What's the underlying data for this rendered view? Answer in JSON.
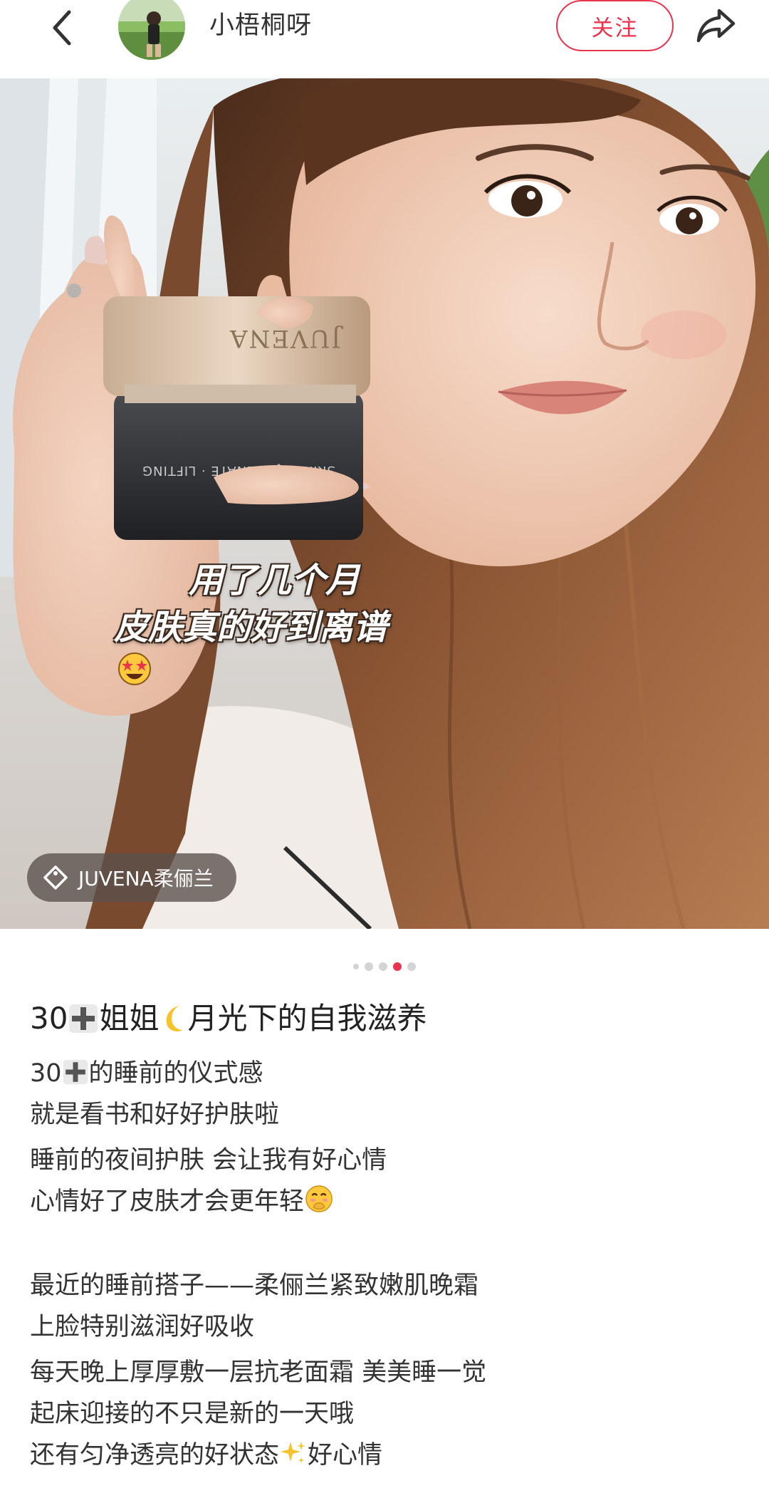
{
  "header": {
    "back_icon": "chevron-left-icon",
    "author_name": "小梧桐呀",
    "follow_label": "关注",
    "share_icon": "share-arrow-icon"
  },
  "photo": {
    "overlay_line1": "用了几个月",
    "overlay_line2": "皮肤真的好到离谱",
    "overlay_emoji": "star-struck-emoji",
    "jar_lid_text": "JUVENA",
    "jar_band_text": "SKIN REJUVENATE · LIFTING",
    "brand_tag": "JUVENA柔俪兰",
    "brand_tag_icon": "tag-icon"
  },
  "pagination": {
    "total": 5,
    "active_index": 3
  },
  "post": {
    "title_part1": "30",
    "title_part2": "姐姐",
    "title_part3": "月光下的自我滋养",
    "lines": {
      "l1_a": "30",
      "l1_b": "的睡前的仪式感",
      "l2": "就是看书和好好护肤啦",
      "l3": "睡前的夜间护肤 会让我有好心情",
      "l4": "心情好了皮肤才会更年轻",
      "l5": "最近的睡前搭子——柔俪兰紧致嫩肌晚霜",
      "l6": "上脸特别滋润好吸收",
      "l7": "每天晚上厚厚敷一层抗老面霜 美美睡一觉",
      "l8": "起床迎接的不只是新的一天哦",
      "l9_a": "还有匀净透亮的好状态",
      "l9_b": "好心情"
    }
  },
  "colors": {
    "accent": "#e8354d",
    "text_primary": "#222222",
    "text_body": "#333333"
  }
}
